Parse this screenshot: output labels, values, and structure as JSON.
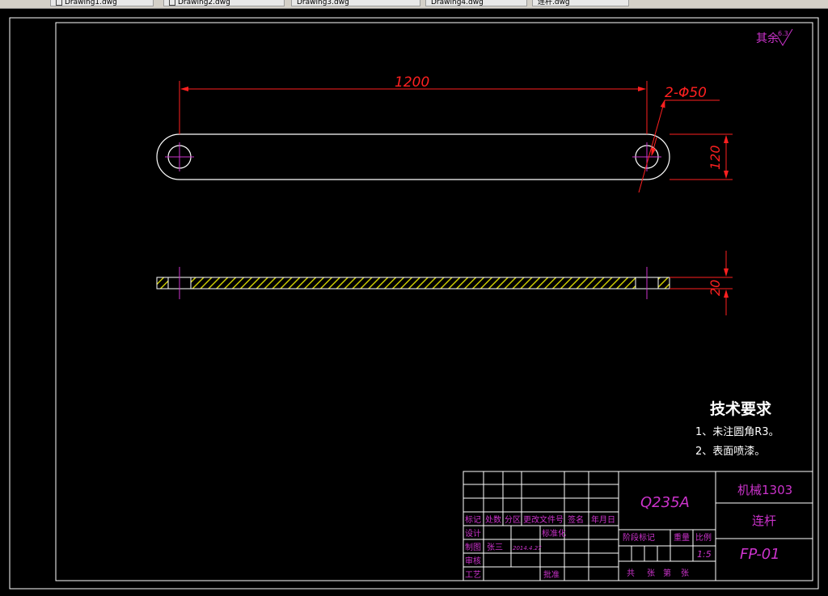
{
  "window": {
    "tabs": [
      {
        "label": "Drawing1.dwg"
      },
      {
        "label": "Drawing2.dwg"
      },
      {
        "label": "Drawing3.dwg"
      },
      {
        "label": "Drawing4.dwg"
      },
      {
        "label": "连杆.dwg"
      }
    ]
  },
  "drawing": {
    "surface_note": "其余",
    "surface_value": "6.3",
    "dims": {
      "length": "1200",
      "holes": "2-Φ50",
      "height": "120",
      "thickness": "20"
    },
    "tech_req": {
      "title": "技术要求",
      "items": [
        "1、未注圆角R3。",
        "2、表面喷漆。"
      ]
    },
    "title_block": {
      "material": "Q235A",
      "school": "机械1303",
      "part_name": "连杆",
      "drawing_no": "FP-01",
      "scale": "1:5",
      "header_labels": [
        "标记",
        "处数",
        "分区",
        "更改文件号",
        "签名",
        "年月日"
      ],
      "design": "设计",
      "standardize": "标准化",
      "drawn": "制图",
      "drawn_by": "张三",
      "drawn_date": "2014.4.27",
      "check": "审核",
      "process": "工艺",
      "approve": "批准",
      "stage_mark": "阶段标记",
      "weight": "重量",
      "scale_label": "比例",
      "sheets_total": "共",
      "sheets_unit1": "张",
      "sheets_no": "第",
      "sheets_unit2": "张"
    },
    "colors": {
      "outline": "#ffffff",
      "dimension": "#ff2020",
      "centerline": "#cc33cc",
      "hatch": "#c8c800",
      "text": "#cc33cc"
    }
  }
}
